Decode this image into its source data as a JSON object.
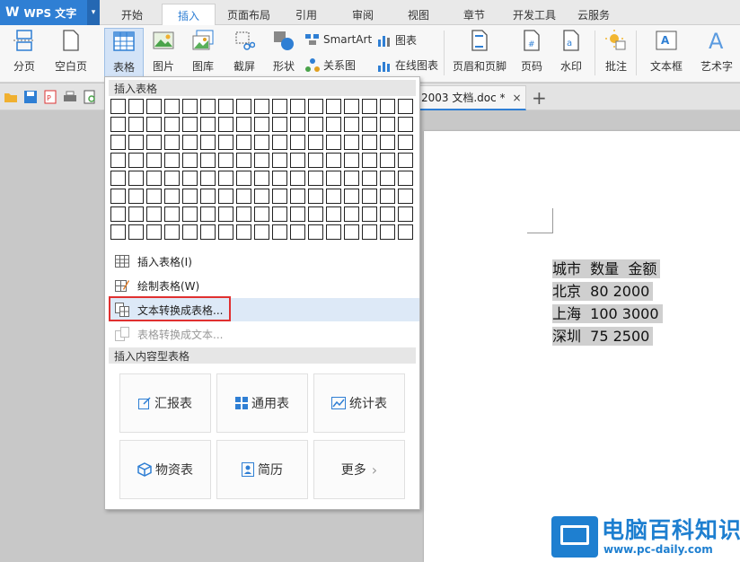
{
  "app": {
    "title": "WPS 文字"
  },
  "ribbon_tabs": [
    "开始",
    "插入",
    "页面布局",
    "引用",
    "审阅",
    "视图",
    "章节",
    "开发工具",
    "云服务"
  ],
  "ribbon": {
    "buttons": [
      "分页",
      "空白页",
      "表格",
      "图片",
      "图库",
      "截屏",
      "形状",
      "页眉和页脚",
      "页码",
      "水印",
      "批注",
      "文本框",
      "艺术字"
    ],
    "small": {
      "smartart": "SmartArt",
      "chart": "图表",
      "relation": "关系图",
      "online_chart": "在线图表"
    }
  },
  "doc_tab": {
    "name": "2003 文档.doc *",
    "close": "×",
    "new": "+"
  },
  "dropdown": {
    "insert_table_header": "插入表格",
    "grid": {
      "cols": 17,
      "rows": 8
    },
    "items": [
      "插入表格(I)",
      "绘制表格(W)",
      "文本转换成表格...",
      "表格转换成文本..."
    ],
    "content_header": "插入内容型表格",
    "cards": [
      "汇报表",
      "通用表",
      "统计表",
      "物资表",
      "简历",
      "更多"
    ],
    "more_arrow": "›"
  },
  "document": {
    "lines": [
      "城市  数量  金额",
      "北京  80 2000",
      "上海  100 3000",
      "深圳  75 2500"
    ]
  },
  "watermark": {
    "title": "电脑百科知识",
    "url": "www.pc-daily.com"
  },
  "colors": {
    "accent": "#2f7fd4",
    "highlight_box": "#e03030",
    "watermark": "#1e7fd0"
  }
}
